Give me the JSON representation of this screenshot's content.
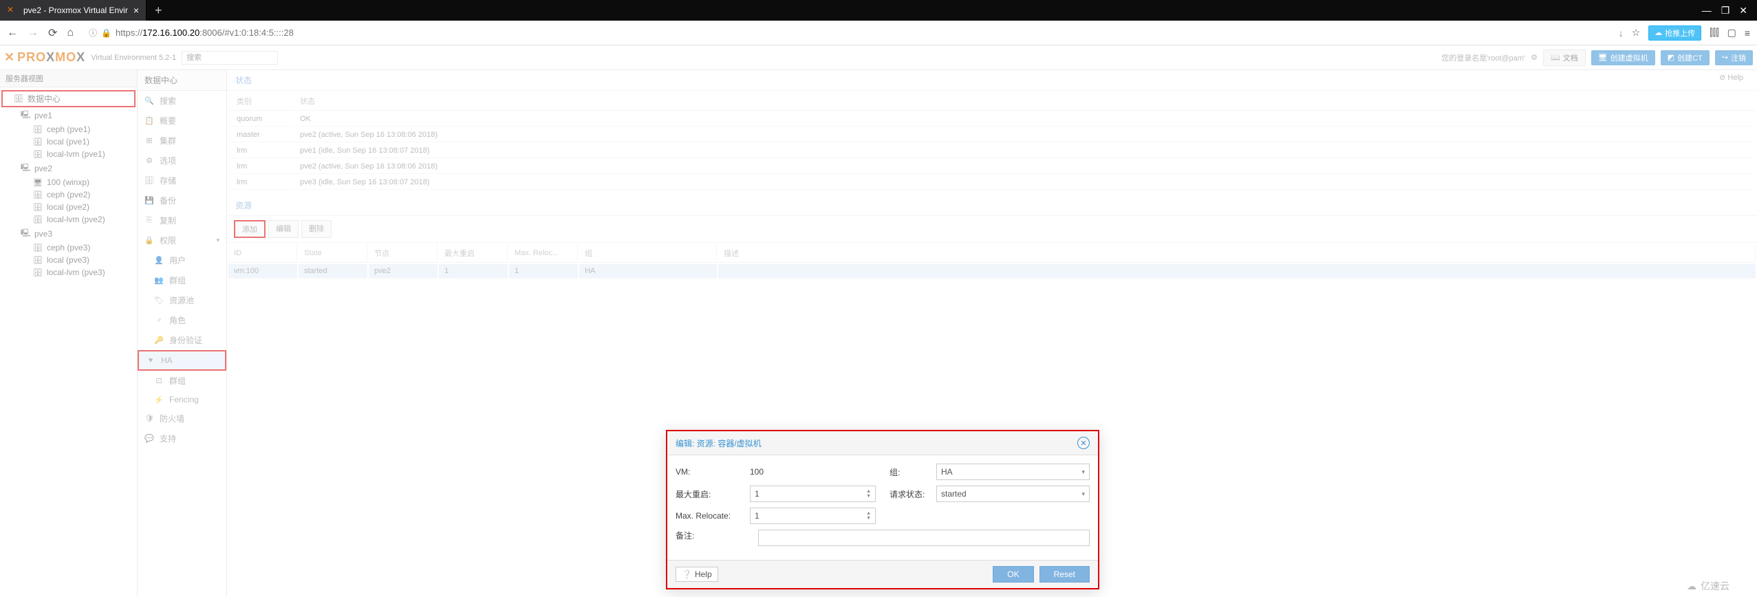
{
  "browser": {
    "tab_title": "pve2 - Proxmox Virtual Envir",
    "url_prefix": "https://",
    "url_host": "172.16.100.20",
    "url_path": ":8006/#v1:0:18:4:5::::28",
    "action_label": "抢推上传"
  },
  "header": {
    "logo": "PROXMOX",
    "version": "Virtual Environment 5.2-1",
    "search_placeholder": "搜索",
    "login_text": "您的登录名是'root@pam'",
    "docs": "文档",
    "create_vm": "创建虚拟机",
    "create_ct": "创建CT",
    "logout": "注销"
  },
  "tree": {
    "header": "服务器视图",
    "datacenter": "数据中心",
    "nodes": [
      {
        "name": "pve1",
        "children": [
          "ceph (pve1)",
          "local (pve1)",
          "local-lvm (pve1)"
        ]
      },
      {
        "name": "pve2",
        "children": [
          "100 (winxp)",
          "ceph (pve2)",
          "local (pve2)",
          "local-lvm (pve2)"
        ]
      },
      {
        "name": "pve3",
        "children": [
          "ceph (pve3)",
          "local (pve3)",
          "local-lvm (pve3)"
        ]
      }
    ]
  },
  "submenu": {
    "title": "数据中心",
    "items": [
      "搜索",
      "概要",
      "集群",
      "选项",
      "存储",
      "备份",
      "复制",
      "权限",
      "用户",
      "群组",
      "资源池",
      "角色",
      "身份验证",
      "HA",
      "群组",
      "Fencing",
      "防火墙",
      "支持"
    ]
  },
  "content": {
    "help": "Help",
    "status_section": "状态",
    "status_cols": [
      "类别",
      "状态"
    ],
    "status_rows": [
      {
        "type": "quorum",
        "status": "OK"
      },
      {
        "type": "master",
        "status": "pve2 (active, Sun Sep 16 13:08:06 2018)"
      },
      {
        "type": "lrm",
        "status": "pve1 (idle, Sun Sep 16 13:08:07 2018)"
      },
      {
        "type": "lrm",
        "status": "pve2 (active, Sun Sep 16 13:08:06 2018)"
      },
      {
        "type": "lrm",
        "status": "pve3 (idle, Sun Sep 16 13:08:07 2018)"
      }
    ],
    "resources_section": "资源",
    "toolbar": {
      "add": "添加",
      "edit": "编辑",
      "remove": "删除"
    },
    "res_cols": [
      "ID",
      "State",
      "节点",
      "最大重启",
      "Max. Reloc...",
      "组",
      "描述"
    ],
    "res_rows": [
      {
        "id": "vm:100",
        "state": "started",
        "node": "pve2",
        "max_restart": "1",
        "max_reloc": "1",
        "group": "HA",
        "desc": ""
      }
    ]
  },
  "dialog": {
    "title": "编辑: 资源: 容器/虚拟机",
    "labels": {
      "vm": "VM:",
      "group": "组:",
      "max_restart": "最大重启:",
      "req_state": "请求状态:",
      "max_relocate": "Max. Relocate:",
      "comment": "备注:"
    },
    "values": {
      "vm": "100",
      "group": "HA",
      "max_restart": "1",
      "req_state": "started",
      "max_relocate": "1",
      "comment": ""
    },
    "buttons": {
      "help": "Help",
      "ok": "OK",
      "reset": "Reset"
    }
  },
  "watermark": "亿速云"
}
